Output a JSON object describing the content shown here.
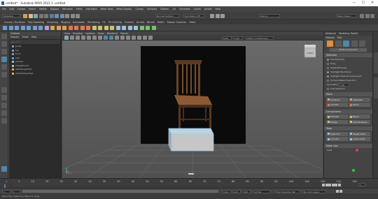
{
  "window": {
    "title": "untitled* - Autodesk MAYA 2023.1: untitled",
    "min": "—",
    "max": "☐",
    "close": "✕"
  },
  "menubar": [
    "File",
    "Edit",
    "Create",
    "Select",
    "Modify",
    "Display",
    "Windows",
    "Mesh",
    "Edit Mesh",
    "Mesh Tools",
    "Mesh Display",
    "Curves",
    "Surfaces",
    "Deform",
    "UV",
    "Generate",
    "Cache",
    "Arnold",
    "Help"
  ],
  "status": {
    "mode": "Modeling",
    "no_live": "No Live Surface",
    "symmetry": "Symmetry: Off",
    "sign_in": "Sign In",
    "workspace": "Maya Classic"
  },
  "shelf_tabs": [
    "Curves / Surfaces",
    "Poly Modeling",
    "Sculpting",
    "Rigging",
    "Animation",
    "Rendering",
    "FX",
    "FX Caching",
    "Custom",
    "Arnold",
    "Bifrost",
    "MASH",
    "Motion Graphics",
    "XGen"
  ],
  "outliner": {
    "title": "Outliner",
    "menu": [
      "Display",
      "Show",
      "Help"
    ],
    "search_placeholder": "Search...",
    "items": [
      "persp",
      "top",
      "front",
      "side",
      "pCube1",
      "imagePlane1",
      "defaultLightSet",
      "defaultObjectSet"
    ]
  },
  "viewport_menu": [
    "View",
    "Shading",
    "Lighting",
    "Show",
    "Renderer",
    "Panels"
  ],
  "viewport_fields": {
    "near": "0.00",
    "far": "1.00",
    "color_space": "ACES 1.0 SDR-video (sRGB)"
  },
  "viewcube_label": "FRONT",
  "right_panel": {
    "tabs": [
      "Attribute",
      "Modeling Toolkit"
    ],
    "menu": [
      "Objects",
      "Edit"
    ],
    "mode_label": "Multi-Component",
    "selection_header": "Selection",
    "pick_marquee": "Pick/Marquee",
    "drag": "Drag",
    "tweak_marquee": "Tweak/Marquee",
    "highlight_backfaces": "Highlight Backfaces",
    "highlight_nearest": "Highlight Nearest Component",
    "camera_based": "Camera Based Selection",
    "symmetry": "Symmetry:",
    "symmetry_val": "Off",
    "soft_selection": "Soft Selection",
    "mesh_header": "Mesh",
    "mesh_btns": [
      "Combine",
      "Separate",
      "Smooth",
      "Mirror"
    ],
    "components_header": "Components",
    "comp_btns": [
      "Extrude",
      "Bevel",
      "Bridge",
      "Add Divisions"
    ],
    "tools_header": "Tools",
    "tool_btns": [
      "Multi-Cut",
      "Target Weld",
      "Connect",
      "Quad Draw"
    ],
    "extra": [
      "Make Live",
      "Slide"
    ]
  },
  "timeline": {
    "ticks": [
      "1",
      "5",
      "10",
      "15",
      "20",
      "25",
      "30",
      "35",
      "40",
      "45",
      "50",
      "55",
      "60",
      "65",
      "70",
      "75",
      "80",
      "85",
      "90",
      "95",
      "100",
      "105",
      "110",
      "115",
      "120"
    ],
    "current": "1"
  },
  "range": {
    "start": "1",
    "start2": "1",
    "end": "120",
    "end2": "120",
    "end3": "200",
    "fps": "24 fps",
    "char_set": "No Character Set",
    "anim_layer": "No Anim Layer"
  },
  "help": "Move Tool: Select an object to drag.",
  "accent": "#5285a6"
}
